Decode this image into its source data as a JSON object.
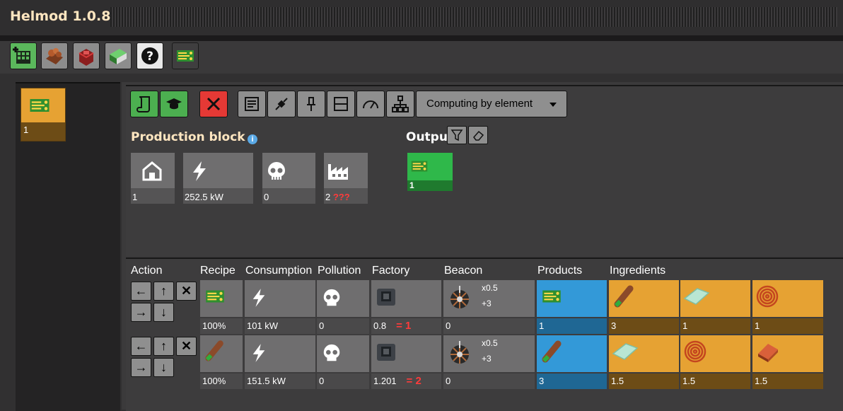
{
  "app": {
    "title": "Helmod 1.0.8"
  },
  "toolbar": {
    "icons": [
      "new-model-icon",
      "copper-ore-icon",
      "red-block-icon",
      "spreadsheet-icon",
      "help-icon",
      "electronic-circuit-icon"
    ]
  },
  "left_panel": {
    "block_value": "1"
  },
  "actions": {
    "icons": [
      "scroll-icon",
      "graduation-cap-icon",
      "close-icon",
      "list-icon",
      "plug-icon",
      "pin-icon",
      "split-icon",
      "gauge-icon",
      "hierarchy-icon"
    ],
    "dropdown_label": "Computing by element"
  },
  "production_block": {
    "title": "Production block",
    "stats": [
      {
        "name": "home",
        "value": "1"
      },
      {
        "name": "power",
        "value": "252.5 kW"
      },
      {
        "name": "pollution",
        "value": "0"
      },
      {
        "name": "factory",
        "value": "2",
        "warning": "???"
      }
    ]
  },
  "output": {
    "title": "Output",
    "items": [
      {
        "value": "1"
      }
    ]
  },
  "table": {
    "headers": [
      "Action",
      "Recipe",
      "Consumption",
      "Pollution",
      "Factory",
      "Beacon",
      "Products",
      "Ingredients"
    ],
    "rows": [
      {
        "recipe_pct": "100%",
        "consumption": "101 kW",
        "pollution": "0",
        "factory": "0.8",
        "factory_count": "= 1",
        "beacon": "0",
        "beacon_mult": "x0.5",
        "beacon_add": "+3",
        "products": [
          "1"
        ],
        "ingredients": [
          "3",
          "1",
          "1"
        ]
      },
      {
        "recipe_pct": "100%",
        "consumption": "151.5 kW",
        "pollution": "0",
        "factory": "1.201",
        "factory_count": "= 2",
        "beacon": "0",
        "beacon_mult": "x0.5",
        "beacon_add": "+3",
        "products": [
          "3"
        ],
        "ingredients": [
          "1.5",
          "1.5",
          "1.5"
        ]
      }
    ]
  },
  "colors": {
    "accent_title": "#ffe6c0",
    "green": "#4caf50",
    "red": "#e53935",
    "blue": "#3399d8",
    "orange": "#e6a233"
  }
}
